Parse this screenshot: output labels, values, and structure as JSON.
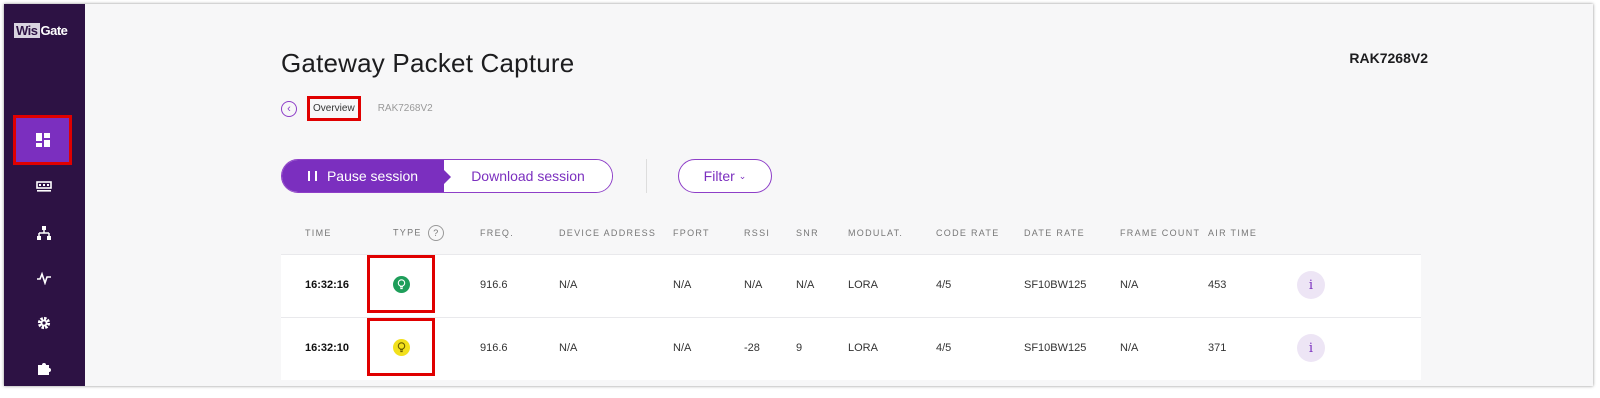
{
  "sidebar": {
    "logo": {
      "part1": "Wis",
      "part2": "Gate"
    },
    "items": [
      {
        "icon": "dashboard-icon",
        "active": true
      },
      {
        "icon": "gateway-icon",
        "active": false
      },
      {
        "icon": "network-icon",
        "active": false
      },
      {
        "icon": "activity-icon",
        "active": false
      },
      {
        "icon": "gear-icon",
        "active": false
      },
      {
        "icon": "puzzle-icon",
        "active": false
      }
    ]
  },
  "header": {
    "title": "Gateway Packet Capture",
    "gateway_name": "RAK7268V2"
  },
  "breadcrumb": {
    "items": [
      "Overview",
      "RAK7268V2"
    ]
  },
  "controls": {
    "pause_label": "Pause session",
    "download_label": "Download session",
    "filter_label": "Filter"
  },
  "table": {
    "headers": [
      "TIME",
      "TYPE",
      "FREQ.",
      "DEVICE ADDRESS",
      "FPORT",
      "RSSI",
      "SNR",
      "MODULAT.",
      "CODE RATE",
      "DATE RATE",
      "FRAME COUNT",
      "AIR TIME"
    ],
    "type_help": "?",
    "info_label": "i",
    "rows": [
      {
        "time": "16:32:16",
        "type_color": "#1e9e5a",
        "freq": "916.6",
        "device_address": "N/A",
        "fport": "N/A",
        "rssi": "N/A",
        "snr": "N/A",
        "modulation": "LORA",
        "code_rate": "4/5",
        "data_rate": "SF10BW125",
        "frame_count": "N/A",
        "air_time": "453"
      },
      {
        "time": "16:32:10",
        "type_color": "#f2e01c",
        "freq": "916.6",
        "device_address": "N/A",
        "fport": "N/A",
        "rssi": "-28",
        "snr": "9",
        "modulation": "LORA",
        "code_rate": "4/5",
        "data_rate": "SF10BW125",
        "frame_count": "N/A",
        "air_time": "371"
      }
    ]
  },
  "colors": {
    "accent": "#7b2fbf",
    "sidebar": "#2d1244",
    "highlight": "#e00000"
  }
}
